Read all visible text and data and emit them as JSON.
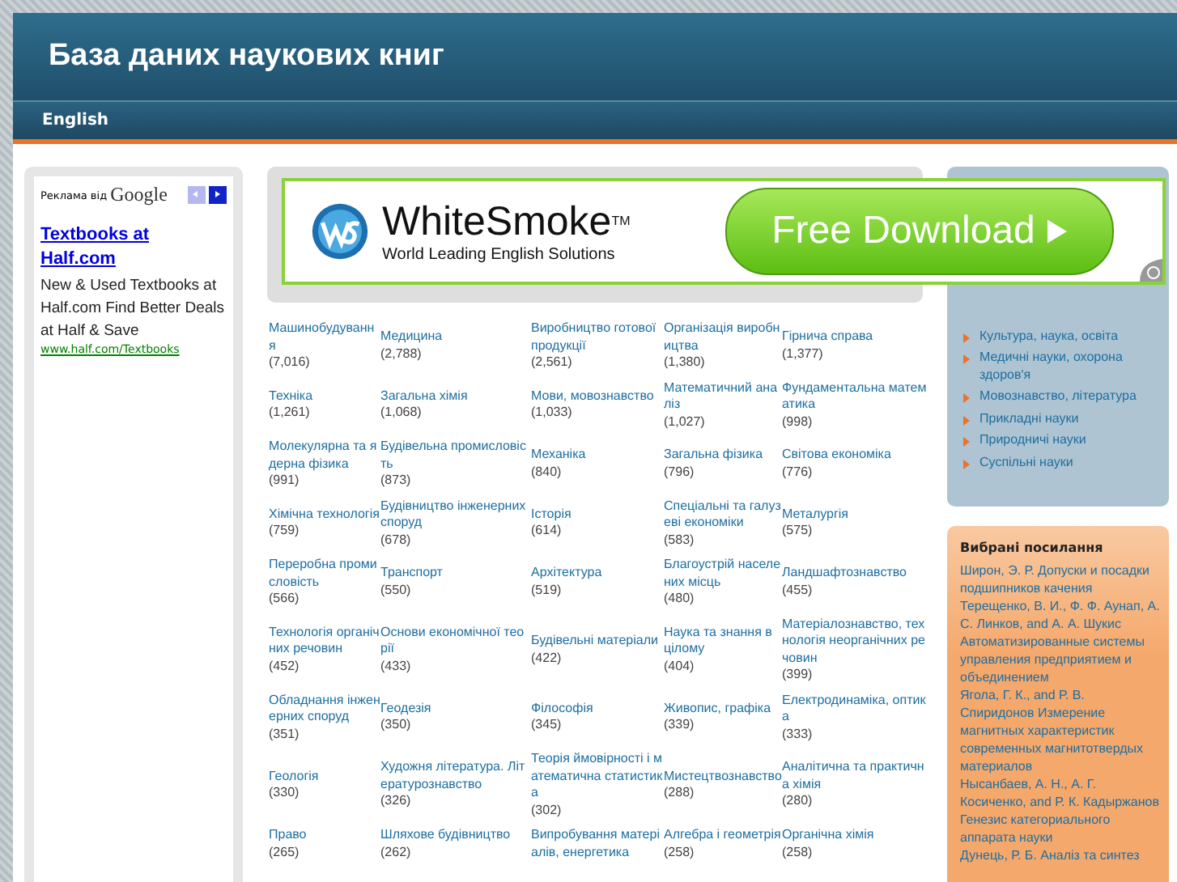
{
  "header": {
    "title": "База даних наукових книг"
  },
  "nav": [
    {
      "label": "English"
    }
  ],
  "ad_sidebar": {
    "label": "Реклама від",
    "brand": "Google",
    "link": "Textbooks at Half.com",
    "text": "New & Used Textbooks at Half.com Find Better Deals at Half & Save",
    "url": "www.half.com/Textbooks"
  },
  "banner": {
    "brand": "WhiteSmoke",
    "trademark": "TM",
    "tagline": "World Leading English Solutions",
    "button": "Free Download"
  },
  "categories": [
    {
      "name": "Машинобудування",
      "count": "(7,016)"
    },
    {
      "name": "Медицина",
      "count": "(2,788)"
    },
    {
      "name": "Виробництво готової продукції",
      "count": "(2,561)"
    },
    {
      "name": "Організація виробництва",
      "count": "(1,380)"
    },
    {
      "name": "Гірнича справа",
      "count": "(1,377)"
    },
    {
      "name": "Техніка",
      "count": "(1,261)"
    },
    {
      "name": "Загальна хімія",
      "count": "(1,068)"
    },
    {
      "name": "Мови, мовознавство",
      "count": "(1,033)"
    },
    {
      "name": "Математичний аналіз",
      "count": "(1,027)"
    },
    {
      "name": "Фундаментальна математика",
      "count": "(998)"
    },
    {
      "name": "Молекулярна та ядерна фізика",
      "count": "(991)"
    },
    {
      "name": "Будівельна промисловість",
      "count": "(873)"
    },
    {
      "name": "Механіка",
      "count": "(840)"
    },
    {
      "name": "Загальна фізика",
      "count": "(796)"
    },
    {
      "name": "Світова економіка",
      "count": "(776)"
    },
    {
      "name": "Хімічна технологія",
      "count": "(759)"
    },
    {
      "name": "Будівництво інженерних споруд",
      "count": "(678)"
    },
    {
      "name": "Історія",
      "count": "(614)"
    },
    {
      "name": "Спеціальні та галузеві економіки",
      "count": "(583)"
    },
    {
      "name": "Металургія",
      "count": "(575)"
    },
    {
      "name": "Переробна промисловість",
      "count": "(566)"
    },
    {
      "name": "Транспорт",
      "count": "(550)"
    },
    {
      "name": "Архітектура",
      "count": "(519)"
    },
    {
      "name": "Благоустрій населених місць",
      "count": "(480)"
    },
    {
      "name": "Ландшафтознавство",
      "count": "(455)"
    },
    {
      "name": "Технологія органічних речовин",
      "count": "(452)"
    },
    {
      "name": "Основи економічної теорії",
      "count": "(433)"
    },
    {
      "name": "Будівельні матеріали",
      "count": "(422)"
    },
    {
      "name": "Наука та знання в цілому",
      "count": "(404)"
    },
    {
      "name": "Матеріалознавство, технологія неорганічних речовин",
      "count": "(399)"
    },
    {
      "name": "Обладнання інженерних споруд",
      "count": "(351)"
    },
    {
      "name": "Геодезія",
      "count": "(350)"
    },
    {
      "name": "Філософія",
      "count": "(345)"
    },
    {
      "name": "Живопис, графіка",
      "count": "(339)"
    },
    {
      "name": "Електродинаміка, оптика",
      "count": "(333)"
    },
    {
      "name": "Геологія",
      "count": "(330)"
    },
    {
      "name": "Художня література. Літературознавство",
      "count": "(326)"
    },
    {
      "name": "Теорія ймовірності і математична статистика",
      "count": "(302)"
    },
    {
      "name": "Мистецтвознавство",
      "count": "(288)"
    },
    {
      "name": "Аналітична та практична хімія",
      "count": "(280)"
    },
    {
      "name": "Право",
      "count": "(265)"
    },
    {
      "name": "Шляхове будівництво",
      "count": "(262)"
    },
    {
      "name": "Випробування матеріалів, енергетика"
    },
    {
      "name": "Алгебра і геометрія",
      "count": "(258)"
    },
    {
      "name": "Органічна хімія",
      "count": "(258)"
    }
  ],
  "sections": {
    "items": [
      "Культура, наука, освіта",
      "Медичні науки, охорона здоров'я",
      "Мовознавство, література",
      "Прикладні науки",
      "Природничі науки",
      "Суспільні науки"
    ]
  },
  "selected_links": {
    "title": "Вибрані посилання",
    "items": [
      "Широн, Э. Р. Допуски и посадки подшипников качения",
      "Терещенко, В. И., Ф. Ф. Аунап, А. С. Линков, and А. А. Шукис Автоматизированные системы управления предприятием и объединением",
      "Ягола, Г. К., and Р. В. Спиридонов Измерение магнитных характеристик современных магнитотвердых материалов",
      "Нысанбаев, А. Н., А. Г. Косиченко, and Р. К. Кадыржанов Генезис категориального аппарата науки",
      "Дунець, Р. Б. Аналіз та синтез"
    ]
  }
}
